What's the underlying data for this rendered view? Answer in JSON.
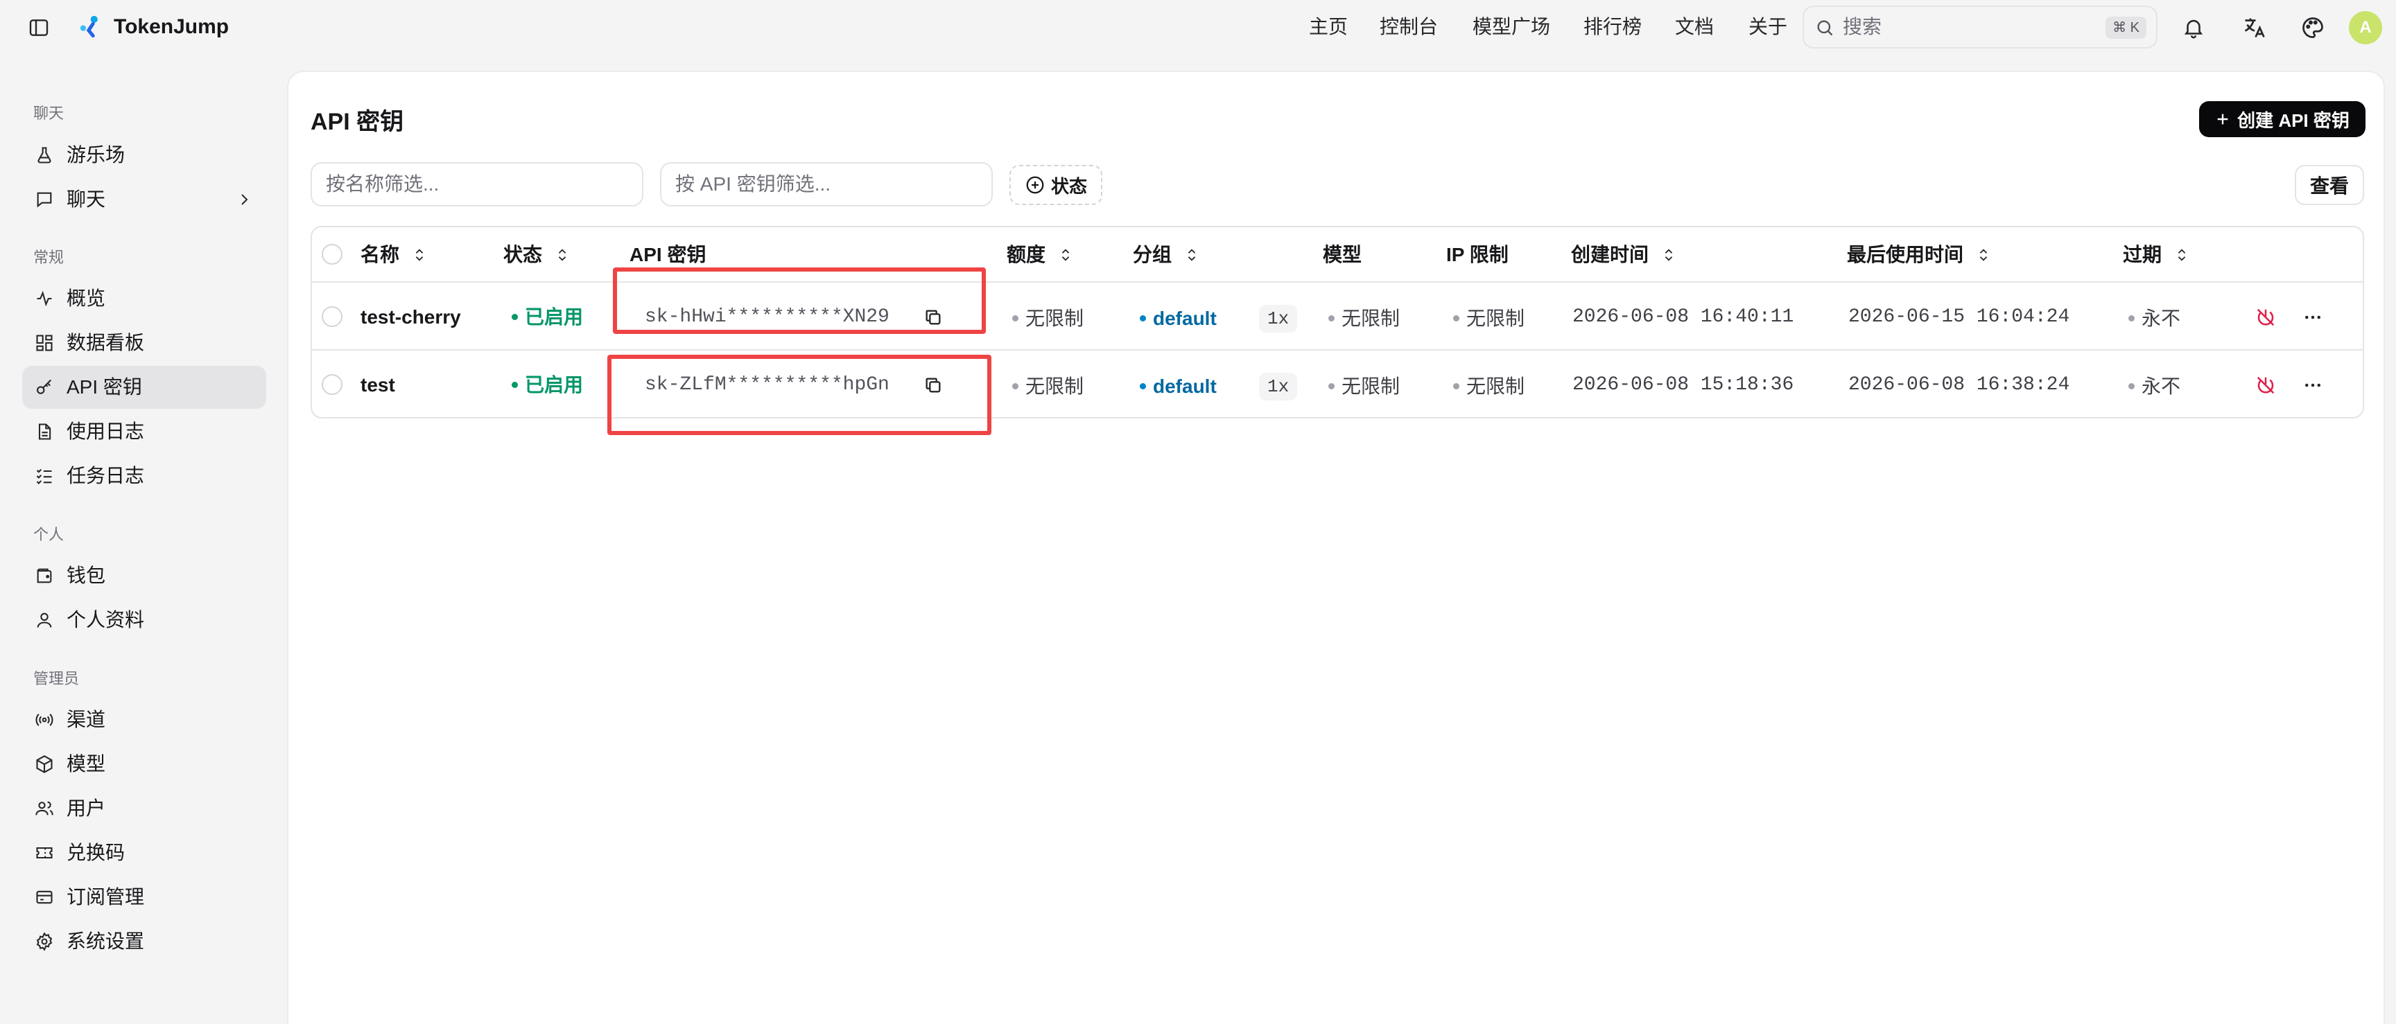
{
  "header": {
    "brand": "TokenJump",
    "nav": [
      "主页",
      "控制台",
      "模型广场",
      "排行榜",
      "文档",
      "关于"
    ],
    "search_placeholder": "搜索",
    "search_shortcut": "⌘ K",
    "avatar_initial": "A"
  },
  "sidebar": {
    "sections": [
      {
        "title": "聊天",
        "items": [
          {
            "label": "游乐场",
            "icon": "flask-icon"
          },
          {
            "label": "聊天",
            "icon": "chat-icon"
          }
        ]
      },
      {
        "title": "常规",
        "items": [
          {
            "label": "概览",
            "icon": "activity-icon"
          },
          {
            "label": "数据看板",
            "icon": "dashboard-icon"
          },
          {
            "label": "API 密钥",
            "icon": "key-icon"
          },
          {
            "label": "使用日志",
            "icon": "file-icon"
          },
          {
            "label": "任务日志",
            "icon": "list-icon"
          }
        ]
      },
      {
        "title": "个人",
        "items": [
          {
            "label": "钱包",
            "icon": "wallet-icon"
          },
          {
            "label": "个人资料",
            "icon": "user-icon"
          }
        ]
      },
      {
        "title": "管理员",
        "items": [
          {
            "label": "渠道",
            "icon": "radio-icon"
          },
          {
            "label": "模型",
            "icon": "cube-icon"
          },
          {
            "label": "用户",
            "icon": "users-icon"
          },
          {
            "label": "兑换码",
            "icon": "ticket-icon"
          },
          {
            "label": "订阅管理",
            "icon": "card-icon"
          },
          {
            "label": "系统设置",
            "icon": "gear-icon"
          }
        ]
      }
    ],
    "active": "API 密钥"
  },
  "page": {
    "title": "API 密钥",
    "create_label": "创建 API 密钥",
    "filter_name_placeholder": "按名称筛选...",
    "filter_key_placeholder": "按 API 密钥筛选...",
    "status_filter_label": "状态",
    "view_label": "查看"
  },
  "table": {
    "columns": [
      "名称",
      "状态",
      "API 密钥",
      "额度",
      "分组",
      "模型",
      "IP 限制",
      "创建时间",
      "最后使用时间",
      "过期"
    ],
    "rows": [
      {
        "name": "test-cherry",
        "status": "已启用",
        "key": "sk-hHwi**********XN29",
        "quota": "无限制",
        "group": "default",
        "ratio": "1x",
        "model": "无限制",
        "ip": "无限制",
        "created": "2026-06-08 16:40:11",
        "last_used": "2026-06-15 16:04:24",
        "expire": "永不"
      },
      {
        "name": "test",
        "status": "已启用",
        "key": "sk-ZLfM**********hpGn",
        "quota": "无限制",
        "group": "default",
        "ratio": "1x",
        "model": "无限制",
        "ip": "无限制",
        "created": "2026-06-08 15:18:36",
        "last_used": "2026-06-08 16:38:24",
        "expire": "永不"
      }
    ]
  },
  "colors": {
    "accent": "#09090b",
    "enabled": "#059669",
    "group": "#0369a1",
    "highlight": "#ef4444",
    "danger": "#e11d48"
  }
}
